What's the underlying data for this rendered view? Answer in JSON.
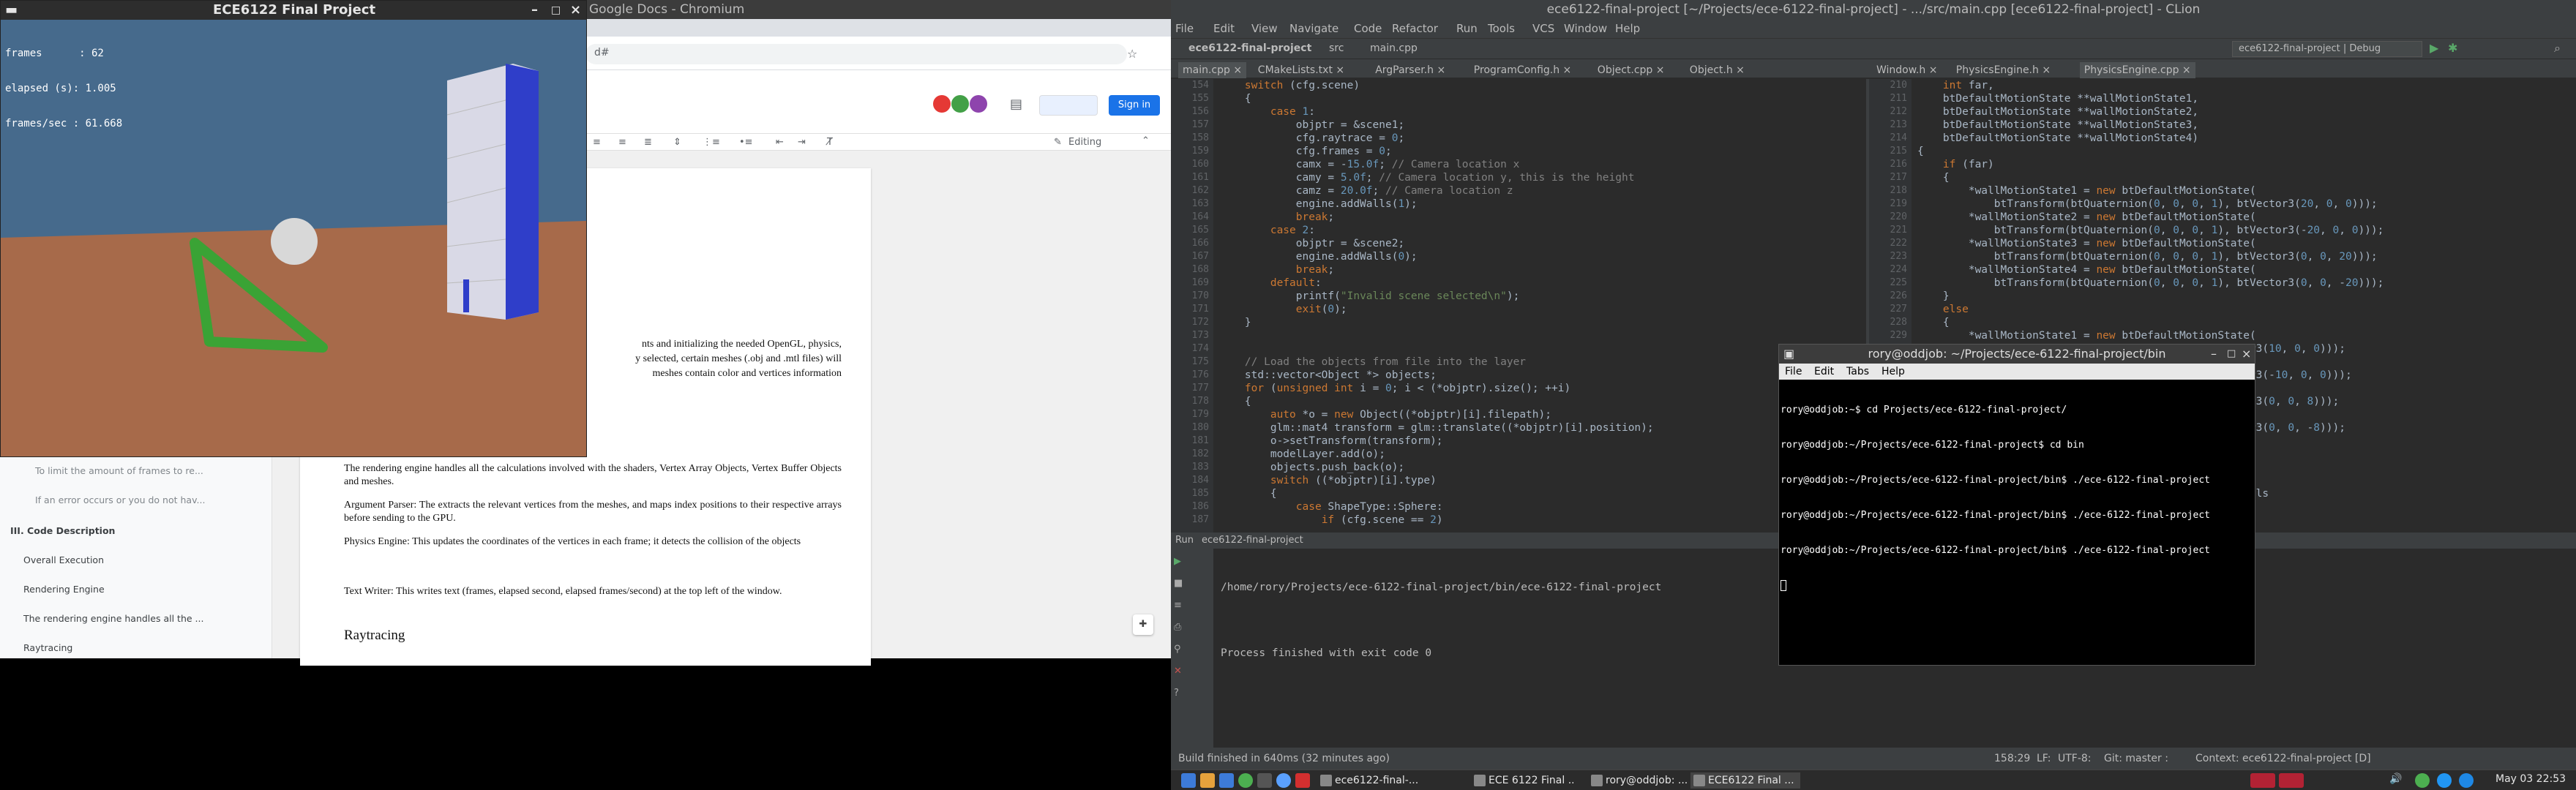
{
  "chromium": {
    "window_title": "Google Docs - Chromium",
    "url_text": "d#",
    "share_button": "Sign in",
    "editing_mode": "Editing",
    "outline": [
      "To limit the amount of frames to re...",
      "If an error occurs or you do not hav...",
      "III. Code Description",
      "Overall Execution",
      "Rendering Engine",
      "The rendering engine handles all the ...",
      "Raytracing"
    ],
    "doc_paragraphs": [
      "nts and initializing the needed OpenGL, physics,",
      "y selected, certain meshes (.obj and .mtl files) will",
      "meshes contain color and vertices information",
      "The rendering engine handles all the calculations involved with the shaders, Vertex Array Objects, Vertex Buffer Objects and meshes.",
      "Argument Parser: The extracts the relevant vertices from the meshes, and maps index positions to their respective arrays before sending to the GPU.",
      "Physics Engine: This updates the coordinates of the vertices in each frame; it detects the collision of the objects",
      "Text Writer: This writes text (frames, elapsed second, elapsed frames/second) at the top left of the window.",
      "Raytracing"
    ]
  },
  "game": {
    "title": "ECE6122 Final Project",
    "overlay_lines": [
      "frames      : 62",
      "elapsed (s): 1.005",
      "frames/sec : 61.668"
    ],
    "colors": {
      "sky": "#466a8c",
      "ground": "#a76a4a",
      "sphere": "#d8d8d8",
      "triangle": "#3aa335",
      "box": "#d9d9e6",
      "box_side": "#2f3ec9"
    }
  },
  "clion": {
    "title": "ece6122-final-project [~/Projects/ece-6122-final-project] - .../src/main.cpp [ece6122-final-project] - CLion",
    "menu": [
      "File",
      "Edit",
      "View",
      "Navigate",
      "Code",
      "Refactor",
      "Run",
      "Tools",
      "VCS",
      "Window",
      "Help"
    ],
    "breadcrumb": [
      "ece6122-final-project",
      "src",
      "main.cpp"
    ],
    "run_config": "ece6122-final-project | Debug",
    "tabs_left": [
      "main.cpp",
      "CMakeLists.txt",
      "ArgParser.h",
      "ProgramConfig.h",
      "Object.cpp",
      "Object.h"
    ],
    "tabs_right": [
      "Window.h",
      "PhysicsEngine.h",
      "PhysicsEngine.cpp"
    ],
    "left_start_line": 154,
    "left_code": [
      "    switch (cfg.scene)",
      "    {",
      "        case 1:",
      "            objptr = &scene1;",
      "            cfg.raytrace = 0;",
      "            cfg.frames = 0;",
      "            camx = -15.0f; // Camera location x",
      "            camy = 5.0f; // Camera location y, this is the height",
      "            camz = 20.0f; // Camera location z",
      "            engine.addWalls(1);",
      "            break;",
      "        case 2:",
      "            objptr = &scene2;",
      "            engine.addWalls(0);",
      "            break;",
      "        default:",
      "            printf(\"Invalid scene selected\\n\");",
      "            exit(0);",
      "    }",
      "",
      "",
      "    // Load the objects from file into the layer",
      "    std::vector<Object *> objects;",
      "    for (unsigned int i = 0; i < (*objptr).size(); ++i)",
      "    {",
      "        auto *o = new Object((*objptr)[i].filepath);",
      "        glm::mat4 transform = glm::translate((*objptr)[i].position);",
      "        o->setTransform(transform);",
      "        modelLayer.add(o);",
      "        objects.push_back(o);",
      "        switch ((*objptr)[i].type)",
      "        {",
      "            case ShapeType::Sphere:",
      "                if (cfg.scene == 2)"
    ],
    "right_start_line": 210,
    "right_code": [
      "    int far,",
      "    btDefaultMotionState **wallMotionState1,",
      "    btDefaultMotionState **wallMotionState2,",
      "    btDefaultMotionState **wallMotionState3,",
      "    btDefaultMotionState **wallMotionState4)",
      "{",
      "    if (far)",
      "    {",
      "        *wallMotionState1 = new btDefaultMotionState(",
      "            btTransform(btQuaternion(0, 0, 0, 1), btVector3(20, 0, 0)));",
      "        *wallMotionState2 = new btDefaultMotionState(",
      "            btTransform(btQuaternion(0, 0, 0, 1), btVector3(-20, 0, 0)));",
      "        *wallMotionState3 = new btDefaultMotionState(",
      "            btTransform(btQuaternion(0, 0, 0, 1), btVector3(0, 0, 20)));",
      "        *wallMotionState4 = new btDefaultMotionState(",
      "            btTransform(btQuaternion(0, 0, 0, 1), btVector3(0, 0, -20)));",
      "    }",
      "    else",
      "    {",
      "        *wallMotionState1 = new btDefaultMotionState(",
      "                                             btVector3(10, 0, 0)));",
      "                                          te(",
      "                                             btVector3(-10, 0, 0)));",
      "                                          te(",
      "                                             btVector3(0, 0, 8)));",
      "                                          te(",
      "                                             btVector3(0, 0, -8)));",
      "",
      "",
      "",
      "",
      "                                      r the short walls"
    ],
    "run_label": "Run",
    "run_tab": "ece6122-final-project",
    "run_output": [
      "/home/rory/Projects/ece-6122-final-project/bin/ece-6122-final-project",
      "",
      "Process finished with exit code 0"
    ],
    "status_left": "Build finished in 640ms (32 minutes ago)",
    "status_right": [
      "158:29",
      "LF:",
      "UTF-8:",
      "Git: master :",
      "Context: ece6122-final-project [D]"
    ]
  },
  "terminal": {
    "title": "rory@oddjob: ~/Projects/ece-6122-final-project/bin",
    "menu": [
      "File",
      "Edit",
      "Tabs",
      "Help"
    ],
    "lines": [
      "rory@oddjob:~$ cd Projects/ece-6122-final-project/",
      "rory@oddjob:~/Projects/ece-6122-final-project$ cd bin",
      "rory@oddjob:~/Projects/ece-6122-final-project/bin$ ./ece-6122-final-project",
      "rory@oddjob:~/Projects/ece-6122-final-project/bin$ ./ece-6122-final-project",
      "rory@oddjob:~/Projects/ece-6122-final-project/bin$ ./ece-6122-final-project"
    ]
  },
  "taskbar": {
    "tasks": [
      "ece6122-final-...",
      "ECE 6122 Final ...",
      "rory@oddjob: ...",
      "ECE6122 Final ..."
    ],
    "clock": "May 03 22:53"
  }
}
